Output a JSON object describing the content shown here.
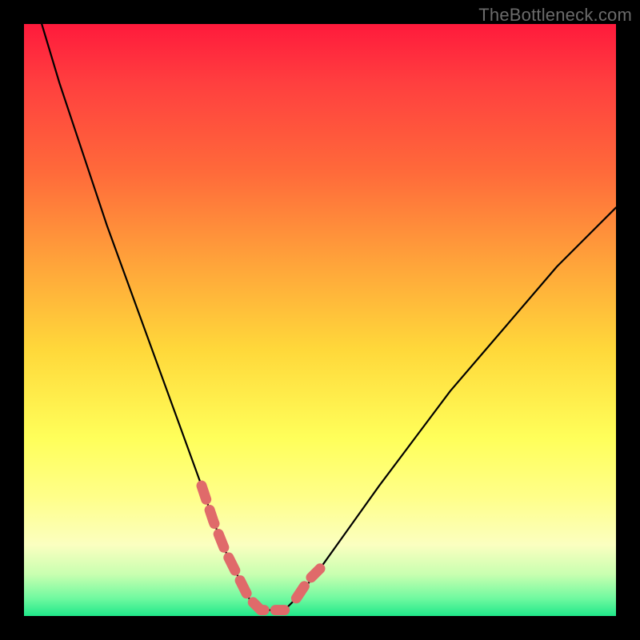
{
  "watermark": {
    "text": "TheBottleneck.com"
  },
  "chart_data": {
    "type": "line",
    "title": "",
    "xlabel": "",
    "ylabel": "",
    "xlim": [
      0,
      100
    ],
    "ylim": [
      0,
      100
    ],
    "grid": false,
    "legend_position": "none",
    "series": [
      {
        "name": "curve",
        "color": "#000000",
        "x": [
          3,
          6,
          10,
          14,
          18,
          22,
          26,
          30,
          32,
          34,
          36,
          37,
          38,
          40,
          42,
          44,
          46,
          50,
          55,
          60,
          66,
          72,
          78,
          84,
          90,
          96,
          100
        ],
        "y": [
          100,
          90,
          78,
          66,
          55,
          44,
          33,
          22,
          16,
          11,
          7,
          5,
          3,
          1,
          1,
          1,
          3,
          8,
          15,
          22,
          30,
          38,
          45,
          52,
          59,
          65,
          69
        ]
      },
      {
        "name": "highlight-left",
        "color": "#e06a6a",
        "x": [
          30,
          32,
          34,
          36,
          37,
          38,
          40,
          42,
          44
        ],
        "y": [
          22,
          16,
          11,
          7,
          5,
          3,
          1,
          1,
          1
        ]
      },
      {
        "name": "highlight-right",
        "color": "#e06a6a",
        "x": [
          46,
          48,
          50
        ],
        "y": [
          3,
          6,
          8
        ]
      }
    ]
  }
}
